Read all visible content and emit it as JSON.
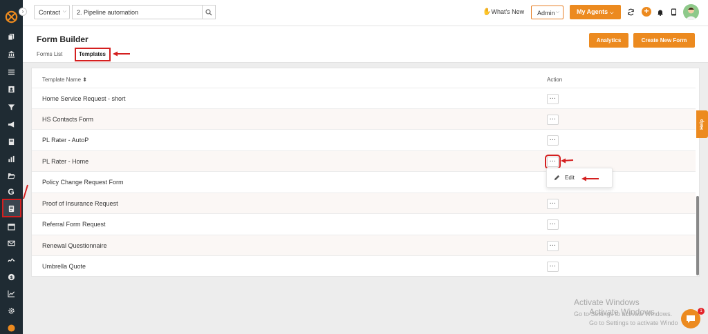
{
  "topbar": {
    "contact_select": "Contact",
    "search_value": "2. Pipeline automation",
    "whats_new": "What's New",
    "admin_select": "Admin",
    "my_agents": "My Agents"
  },
  "header": {
    "title": "Form Builder",
    "tabs": [
      "Forms List",
      "Templates"
    ],
    "analytics_button": "Analytics",
    "create_button": "Create New Form"
  },
  "table": {
    "columns": [
      "Template Name ⬍",
      "Action"
    ],
    "rows": [
      "Home Service Request - short",
      "HS Contacts Form",
      "PL Rater - AutoP",
      "PL Rater - Home",
      "Policy Change Request Form",
      "Proof of Insurance Request",
      "Referral Form Request",
      "Renewal Questionnaire",
      "Umbrella Quote"
    ],
    "action_symbol": "…"
  },
  "context_menu": {
    "edit": "Edit"
  },
  "help_tab": "Help",
  "watermark": {
    "line1": "Activate Windows",
    "line2": "Activate Windows",
    "line3": "Go to Settings to activate Windows.",
    "line4": "Go to Settings to activate Windo"
  },
  "chat_badge": "1",
  "colors": {
    "accent": "#ec8a1f",
    "sidebar": "#1f2b33",
    "annotation": "#d41f1f"
  }
}
